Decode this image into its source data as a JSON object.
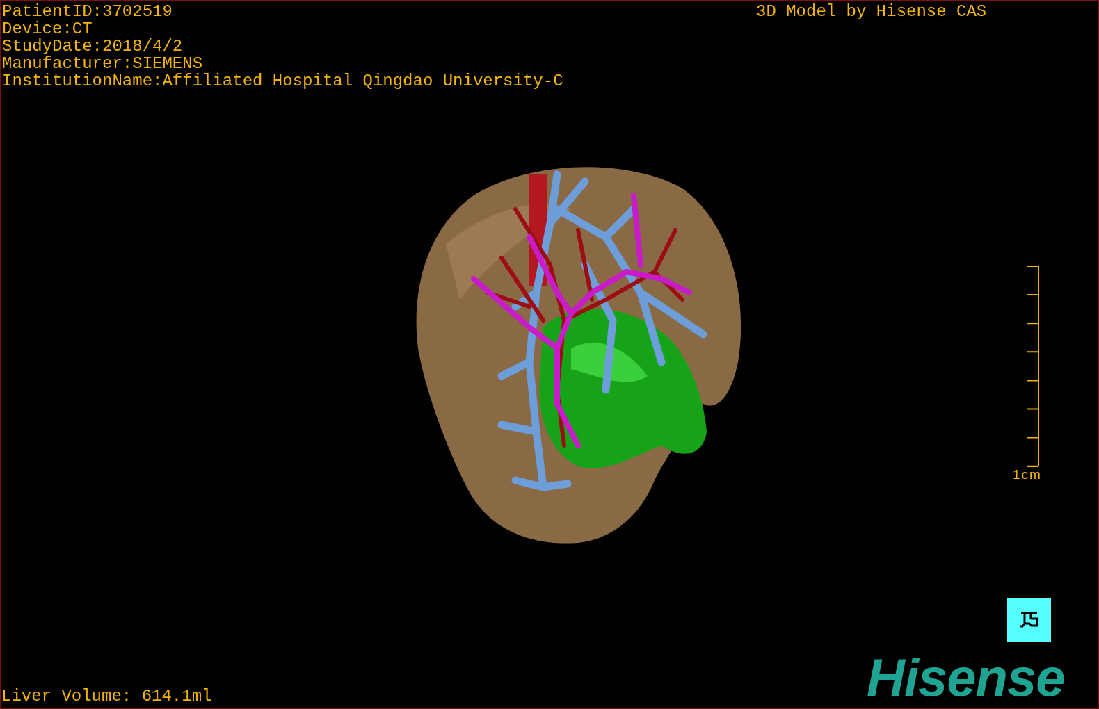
{
  "info_lines": [
    "PatientID:3702519",
    "Device:CT",
    "StudyDate:2018/4/2",
    "Manufacturer:SIEMENS",
    "InstitutionName:Affiliated Hospital Qingdao University-C"
  ],
  "model_credit": "3D Model by Hisense CAS",
  "scale_bar": {
    "label": "1cm"
  },
  "liver_volume": "Liver Volume: 614.1ml",
  "logo": "Hisense"
}
